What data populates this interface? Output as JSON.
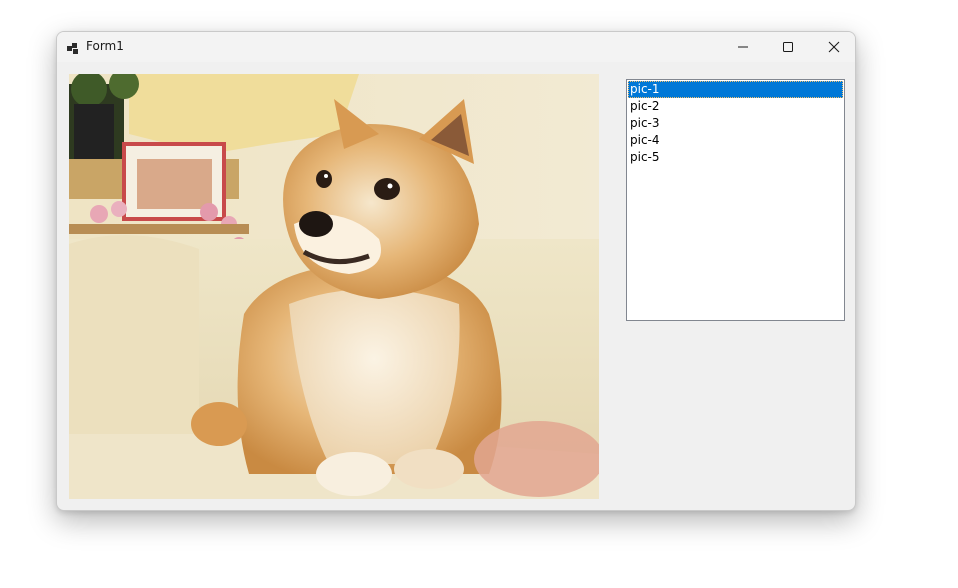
{
  "window": {
    "title": "Form1",
    "icons": {
      "app": "winforms-app-icon",
      "minimize": "minimize-icon",
      "maximize": "maximize-icon",
      "close": "close-icon"
    }
  },
  "picture": {
    "subject": "shiba-inu-dog-photo"
  },
  "listbox": {
    "items": [
      {
        "label": "pic-1",
        "selected": true
      },
      {
        "label": "pic-2",
        "selected": false
      },
      {
        "label": "pic-3",
        "selected": false
      },
      {
        "label": "pic-4",
        "selected": false
      },
      {
        "label": "pic-5",
        "selected": false
      }
    ],
    "selection_color": "#0078d7"
  }
}
